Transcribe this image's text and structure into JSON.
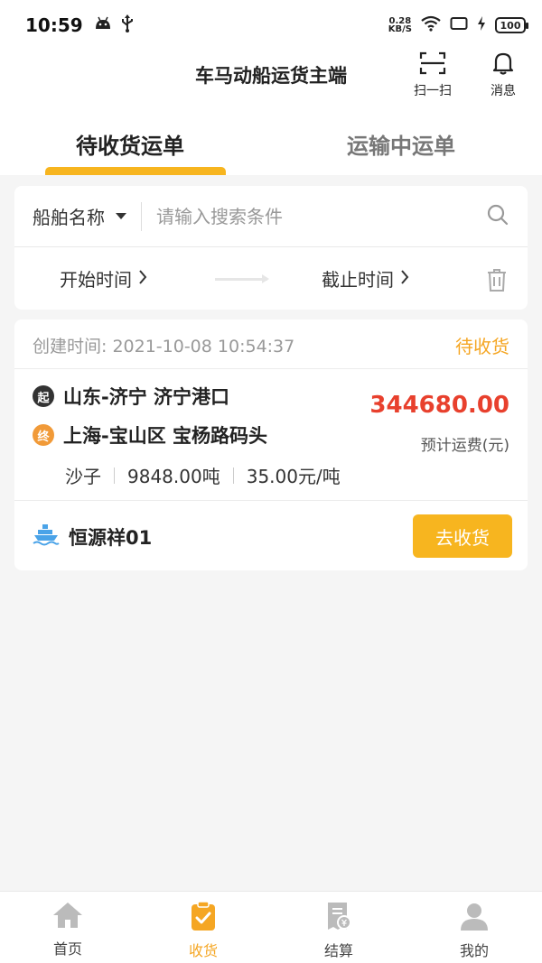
{
  "status_bar": {
    "time": "10:59",
    "speed_value": "0.28",
    "speed_unit": "KB/S",
    "battery": "100"
  },
  "header": {
    "title": "车马动船运货主端",
    "scan_label": "扫一扫",
    "message_label": "消息"
  },
  "tabs": [
    {
      "label": "待收货运单",
      "active": true
    },
    {
      "label": "运输中运单",
      "active": false
    }
  ],
  "search": {
    "ship_select_label": "船舶名称",
    "placeholder": "请输入搜索条件",
    "start_time_label": "开始时间",
    "end_time_label": "截止时间"
  },
  "order": {
    "created_label": "创建时间: 2021-10-08 10:54:37",
    "status": "待收货",
    "start_badge": "起",
    "start_location": "山东-济宁 济宁港口",
    "end_badge": "终",
    "end_location": "上海-宝山区 宝杨路码头",
    "price": "344680.00",
    "price_label": "预计运费(元)",
    "cargo_type": "沙子",
    "cargo_weight": "9848.00吨",
    "cargo_rate": "35.00元/吨",
    "ship_name": "恒源祥01",
    "action_label": "去收货"
  },
  "bottom_nav": [
    {
      "label": "首页",
      "icon": "home-icon",
      "active": false
    },
    {
      "label": "收货",
      "icon": "clipboard-check-icon",
      "active": true
    },
    {
      "label": "结算",
      "icon": "bill-icon",
      "active": false
    },
    {
      "label": "我的",
      "icon": "user-icon",
      "active": false
    }
  ],
  "colors": {
    "accent": "#f7b51f",
    "price": "#e8402d",
    "ship_icon": "#4aa3e8"
  }
}
